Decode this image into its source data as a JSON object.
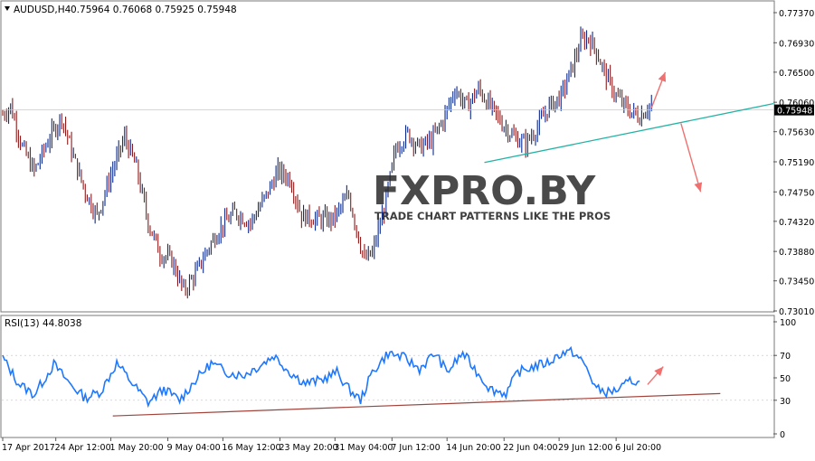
{
  "chart_data": [
    {
      "type": "candlestick",
      "header": {
        "menu_icon": "dropdown-triangle-icon",
        "symbol": "AUDUSD,H4",
        "ohlc": "0.75964 0.76068 0.75925 0.75948"
      },
      "y_ticks": [
        "0.77370",
        "0.76930",
        "0.76500",
        "0.76060",
        "0.75630",
        "0.75190",
        "0.74750",
        "0.74320",
        "0.73880",
        "0.73450",
        "0.73010"
      ],
      "ylim": [
        0.7301,
        0.7737
      ],
      "current_price_label": "0.75948",
      "current_price": 0.75948,
      "colors": {
        "bull": "#0b2a8c",
        "bear": "#8b1a1a",
        "trendline": "#22b3a6",
        "arrow": "#f07070"
      },
      "approx_close_path": [
        {
          "x": 0,
          "y": 0.7588
        },
        {
          "x": 4,
          "y": 0.76
        },
        {
          "x": 10,
          "y": 0.754
        },
        {
          "x": 16,
          "y": 0.7505
        },
        {
          "x": 24,
          "y": 0.7555
        },
        {
          "x": 30,
          "y": 0.7585
        },
        {
          "x": 36,
          "y": 0.7525
        },
        {
          "x": 42,
          "y": 0.7475
        },
        {
          "x": 48,
          "y": 0.744
        },
        {
          "x": 55,
          "y": 0.75
        },
        {
          "x": 62,
          "y": 0.7555
        },
        {
          "x": 68,
          "y": 0.751
        },
        {
          "x": 74,
          "y": 0.743
        },
        {
          "x": 80,
          "y": 0.7385
        },
        {
          "x": 86,
          "y": 0.7375
        },
        {
          "x": 92,
          "y": 0.733
        },
        {
          "x": 98,
          "y": 0.7355
        },
        {
          "x": 104,
          "y": 0.739
        },
        {
          "x": 110,
          "y": 0.742
        },
        {
          "x": 118,
          "y": 0.7445
        },
        {
          "x": 126,
          "y": 0.743
        },
        {
          "x": 134,
          "y": 0.747
        },
        {
          "x": 140,
          "y": 0.7505
        },
        {
          "x": 146,
          "y": 0.7495
        },
        {
          "x": 152,
          "y": 0.744
        },
        {
          "x": 160,
          "y": 0.7435
        },
        {
          "x": 168,
          "y": 0.7435
        },
        {
          "x": 176,
          "y": 0.747
        },
        {
          "x": 180,
          "y": 0.742
        },
        {
          "x": 184,
          "y": 0.7375
        },
        {
          "x": 188,
          "y": 0.7385
        },
        {
          "x": 194,
          "y": 0.745
        },
        {
          "x": 200,
          "y": 0.754
        },
        {
          "x": 206,
          "y": 0.756
        },
        {
          "x": 212,
          "y": 0.754
        },
        {
          "x": 218,
          "y": 0.755
        },
        {
          "x": 224,
          "y": 0.758
        },
        {
          "x": 230,
          "y": 0.7625
        },
        {
          "x": 236,
          "y": 0.76
        },
        {
          "x": 242,
          "y": 0.7625
        },
        {
          "x": 248,
          "y": 0.76
        },
        {
          "x": 254,
          "y": 0.7575
        },
        {
          "x": 260,
          "y": 0.7555
        },
        {
          "x": 266,
          "y": 0.7545
        },
        {
          "x": 272,
          "y": 0.757
        },
        {
          "x": 278,
          "y": 0.76
        },
        {
          "x": 284,
          "y": 0.7615
        },
        {
          "x": 290,
          "y": 0.766
        },
        {
          "x": 294,
          "y": 0.7695
        },
        {
          "x": 298,
          "y": 0.77
        },
        {
          "x": 302,
          "y": 0.768
        },
        {
          "x": 306,
          "y": 0.765
        },
        {
          "x": 312,
          "y": 0.7615
        },
        {
          "x": 318,
          "y": 0.7595
        },
        {
          "x": 324,
          "y": 0.7585
        },
        {
          "x": 330,
          "y": 0.7605
        }
      ],
      "trendline": {
        "from": {
          "x": 245,
          "y": 0.7518
        },
        "to": {
          "x": 392,
          "y": 0.7604
        }
      },
      "forecast_up_arrow": {
        "from": {
          "x": 330,
          "y": 0.7598
        },
        "to": {
          "x": 337,
          "y": 0.765
        }
      },
      "forecast_down_arrow": {
        "from": {
          "x": 345,
          "y": 0.7575
        },
        "to": {
          "x": 355,
          "y": 0.7475
        }
      },
      "x_tick_labels": [
        "17 Apr 2017",
        "24 Apr 12:00",
        "1 May 20:00",
        "9 May 04:00",
        "16 May 12:00",
        "23 May 20:00",
        "31 May 04:00",
        "7 Jun 12:00",
        "14 Jun 20:00",
        "22 Jun 04:00",
        "29 Jun 12:00",
        "6 Jul 20:00"
      ],
      "x_tick_positions": [
        0,
        27,
        55,
        84,
        112,
        141,
        169,
        198,
        226,
        255,
        283,
        312
      ],
      "x_domain": [
        0,
        392
      ]
    },
    {
      "type": "line",
      "title": "RSI(13) 44.8038",
      "ylim": [
        0,
        100
      ],
      "y_ticks": [
        "100",
        "70",
        "50",
        "30",
        "0"
      ],
      "color": "#1e78ff",
      "trendline_color": "#a0433b",
      "approx_values": [
        {
          "x": 0,
          "y": 68
        },
        {
          "x": 8,
          "y": 45
        },
        {
          "x": 16,
          "y": 35
        },
        {
          "x": 26,
          "y": 62
        },
        {
          "x": 34,
          "y": 45
        },
        {
          "x": 42,
          "y": 32
        },
        {
          "x": 50,
          "y": 38
        },
        {
          "x": 58,
          "y": 63
        },
        {
          "x": 66,
          "y": 45
        },
        {
          "x": 74,
          "y": 28
        },
        {
          "x": 82,
          "y": 40
        },
        {
          "x": 90,
          "y": 30
        },
        {
          "x": 98,
          "y": 48
        },
        {
          "x": 106,
          "y": 63
        },
        {
          "x": 114,
          "y": 55
        },
        {
          "x": 122,
          "y": 52
        },
        {
          "x": 130,
          "y": 60
        },
        {
          "x": 138,
          "y": 70
        },
        {
          "x": 146,
          "y": 55
        },
        {
          "x": 154,
          "y": 45
        },
        {
          "x": 162,
          "y": 48
        },
        {
          "x": 170,
          "y": 55
        },
        {
          "x": 176,
          "y": 40
        },
        {
          "x": 182,
          "y": 30
        },
        {
          "x": 188,
          "y": 55
        },
        {
          "x": 196,
          "y": 72
        },
        {
          "x": 204,
          "y": 68
        },
        {
          "x": 212,
          "y": 58
        },
        {
          "x": 220,
          "y": 72
        },
        {
          "x": 226,
          "y": 55
        },
        {
          "x": 234,
          "y": 72
        },
        {
          "x": 240,
          "y": 58
        },
        {
          "x": 248,
          "y": 40
        },
        {
          "x": 256,
          "y": 36
        },
        {
          "x": 262,
          "y": 55
        },
        {
          "x": 270,
          "y": 60
        },
        {
          "x": 278,
          "y": 64
        },
        {
          "x": 284,
          "y": 72
        },
        {
          "x": 290,
          "y": 73
        },
        {
          "x": 296,
          "y": 62
        },
        {
          "x": 302,
          "y": 40
        },
        {
          "x": 308,
          "y": 37
        },
        {
          "x": 314,
          "y": 40
        },
        {
          "x": 320,
          "y": 48
        },
        {
          "x": 324,
          "y": 45
        }
      ],
      "trendline": {
        "from": {
          "x": 56,
          "y": 16
        },
        "to": {
          "x": 365,
          "y": 36
        }
      },
      "forecast_arrow": {
        "from": {
          "x": 328,
          "y": 44
        },
        "to": {
          "x": 336,
          "y": 60
        }
      }
    }
  ],
  "watermark": {
    "logo": "FXPRO.BY",
    "tagline": "TRADE CHART PATTERNS LIKE THE PROS"
  }
}
